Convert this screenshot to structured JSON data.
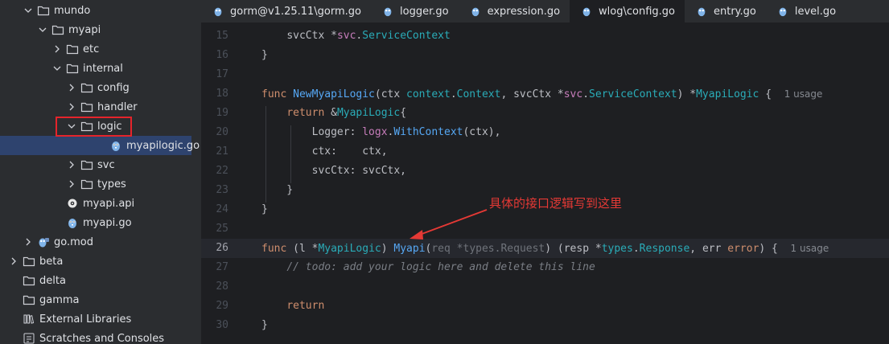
{
  "tree": [
    {
      "label": "mundo",
      "indent": 1,
      "chevron": "down",
      "icon": "folder"
    },
    {
      "label": "myapi",
      "indent": 2,
      "chevron": "down",
      "icon": "folder"
    },
    {
      "label": "etc",
      "indent": 3,
      "chevron": "right",
      "icon": "folder"
    },
    {
      "label": "internal",
      "indent": 3,
      "chevron": "down",
      "icon": "folder"
    },
    {
      "label": "config",
      "indent": 4,
      "chevron": "right",
      "icon": "folder"
    },
    {
      "label": "handler",
      "indent": 4,
      "chevron": "right",
      "icon": "folder"
    },
    {
      "label": "logic",
      "indent": 4,
      "chevron": "down",
      "icon": "folder"
    },
    {
      "label": "myapilogic.go",
      "indent": 6,
      "chevron": "none",
      "icon": "go-file",
      "selected": true
    },
    {
      "label": "svc",
      "indent": 4,
      "chevron": "right",
      "icon": "folder"
    },
    {
      "label": "types",
      "indent": 4,
      "chevron": "right",
      "icon": "folder"
    },
    {
      "label": "myapi.api",
      "indent": 3,
      "chevron": "none",
      "icon": "api-file"
    },
    {
      "label": "myapi.go",
      "indent": 3,
      "chevron": "none",
      "icon": "go-file"
    },
    {
      "label": "go.mod",
      "indent": 1,
      "chevron": "right",
      "icon": "gomod-file"
    },
    {
      "label": "beta",
      "indent": 0,
      "chevron": "right",
      "icon": "folder"
    },
    {
      "label": "delta",
      "indent": 0,
      "chevron": "none",
      "icon": "folder"
    },
    {
      "label": "gamma",
      "indent": 0,
      "chevron": "none",
      "icon": "folder"
    },
    {
      "label": "External Libraries",
      "indent": 0,
      "chevron": "none",
      "icon": "library"
    },
    {
      "label": "Scratches and Consoles",
      "indent": 0,
      "chevron": "none",
      "icon": "scratches"
    }
  ],
  "tabs": [
    {
      "label": "gorm@v1.25.11\\gorm.go"
    },
    {
      "label": "logger.go"
    },
    {
      "label": "expression.go"
    },
    {
      "label": "wlog\\config.go",
      "active": true
    },
    {
      "label": "entry.go"
    },
    {
      "label": "level.go"
    }
  ],
  "editor": {
    "current_line": "26",
    "lines": [
      {
        "n": "15",
        "tokens": [
          [
            "",
            "    "
          ],
          [
            "",
            "svcCtx "
          ],
          [
            "",
            "*"
          ],
          [
            "pkg",
            "svc"
          ],
          [
            "",
            "."
          ],
          [
            "ty",
            "ServiceContext"
          ]
        ]
      },
      {
        "n": "16",
        "tokens": [
          [
            "",
            "}"
          ]
        ]
      },
      {
        "n": "17",
        "tokens": []
      },
      {
        "n": "18",
        "tokens": [
          [
            "kw",
            "func "
          ],
          [
            "fn",
            "NewMyapiLogic"
          ],
          [
            "",
            "(ctx "
          ],
          [
            "ty",
            "context"
          ],
          [
            "",
            "."
          ],
          [
            "ty",
            "Context"
          ],
          [
            "",
            ", svcCtx "
          ],
          [
            "",
            "*"
          ],
          [
            "pkg",
            "svc"
          ],
          [
            "",
            "."
          ],
          [
            "ty",
            "ServiceContext"
          ],
          [
            "",
            ") *"
          ],
          [
            "ty",
            "MyapiLogic"
          ],
          [
            "",
            {
              "text": " {  "
            }
          ],
          [
            "usage",
            "1 usage"
          ]
        ]
      },
      {
        "n": "19",
        "tokens": [
          [
            "",
            "    "
          ],
          [
            "kw",
            "return "
          ],
          [
            "",
            "&"
          ],
          [
            "ty",
            "MyapiLogic"
          ],
          [
            "",
            "{"
          ]
        ]
      },
      {
        "n": "20",
        "tokens": [
          [
            "",
            "        Logger: "
          ],
          [
            "pkg",
            "logx"
          ],
          [
            "",
            "."
          ],
          [
            "fn",
            "WithContext"
          ],
          [
            "",
            "(ctx),"
          ]
        ]
      },
      {
        "n": "21",
        "tokens": [
          [
            "",
            "        ctx:    ctx,"
          ]
        ]
      },
      {
        "n": "22",
        "tokens": [
          [
            "",
            "        svcCtx: svcCtx,"
          ]
        ]
      },
      {
        "n": "23",
        "tokens": [
          [
            "",
            "    }"
          ]
        ]
      },
      {
        "n": "24",
        "tokens": [
          [
            "",
            "}"
          ]
        ]
      },
      {
        "n": "25",
        "tokens": []
      },
      {
        "n": "26",
        "tokens": [
          [
            "kw",
            "func "
          ],
          [
            "",
            "(l "
          ],
          [
            "",
            "*"
          ],
          [
            "ty",
            "MyapiLogic"
          ],
          [
            "",
            ") "
          ],
          [
            "fn",
            "Myapi"
          ],
          [
            "",
            "("
          ],
          [
            "dim",
            "req "
          ],
          [
            "dim",
            "*types.Request"
          ],
          [
            "",
            ") (resp "
          ],
          [
            "",
            "*"
          ],
          [
            "ty",
            "types"
          ],
          [
            "",
            "."
          ],
          [
            "ty",
            "Response"
          ],
          [
            "",
            ", err "
          ],
          [
            "err",
            "error"
          ],
          [
            "",
            ") {  "
          ],
          [
            "usage",
            "1 usage"
          ]
        ]
      },
      {
        "n": "27",
        "tokens": [
          [
            "",
            "    "
          ],
          [
            "cmt",
            "// todo: add your logic here and delete this line"
          ]
        ]
      },
      {
        "n": "28",
        "tokens": []
      },
      {
        "n": "29",
        "tokens": [
          [
            "",
            "    "
          ],
          [
            "kw",
            "return"
          ]
        ]
      },
      {
        "n": "30",
        "tokens": [
          [
            "",
            "}"
          ]
        ]
      }
    ]
  },
  "annotation": {
    "text": "具体的接口逻辑写到这里",
    "color": "#e53935"
  },
  "colors": {
    "accent_selection": "#2e436e",
    "highlight_box": "#e5242b"
  }
}
